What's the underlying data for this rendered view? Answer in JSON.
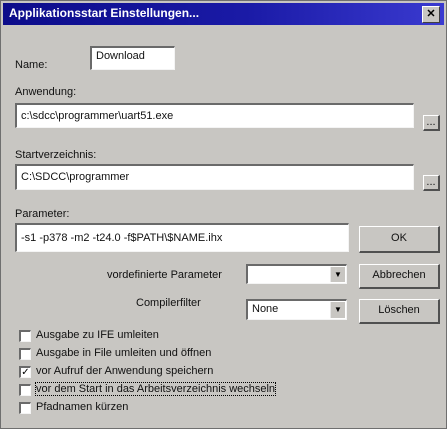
{
  "window": {
    "title": "Applikationsstart Einstellungen...",
    "close_label": "✕"
  },
  "name": {
    "label": "Name:",
    "value": "Download"
  },
  "anwendung": {
    "label": "Anwendung:",
    "value": "c:\\sdcc\\programmer\\uart51.exe",
    "browse_label": "..."
  },
  "startverzeichnis": {
    "label": "Startverzeichnis:",
    "value": "C:\\SDCC\\programmer",
    "browse_label": "..."
  },
  "parameter": {
    "label": "Parameter:",
    "value": "-s1 -p378 -m2 -t24.0 -f$PATH\\$NAME.ihx"
  },
  "predefined": {
    "label": "vordefinierte Parameter",
    "value": ""
  },
  "compilerfilter": {
    "label": "Compilerfilter",
    "value": "None"
  },
  "buttons": {
    "ok": "OK",
    "cancel": "Abbrechen",
    "delete": "Löschen"
  },
  "checkboxes": [
    {
      "label": "Ausgabe zu IFE umleiten",
      "checked": false
    },
    {
      "label": "Ausgabe in File umleiten und öffnen",
      "checked": false
    },
    {
      "label": "vor Aufruf der Anwendung speichern",
      "checked": true
    },
    {
      "label": "vor dem Start in das Arbeitsverzeichnis wechseln",
      "checked": false
    },
    {
      "label": "Pfadnamen kürzen",
      "checked": false
    }
  ]
}
